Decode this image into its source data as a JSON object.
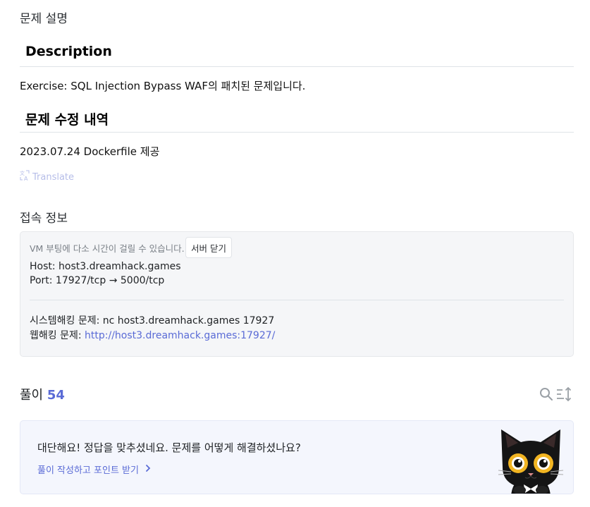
{
  "problem_description": {
    "section_label": "문제 설명",
    "heading": "Description",
    "text": "Exercise: SQL Injection Bypass WAF의 패치된 문제입니다.",
    "revision_heading": "문제 수정 내역",
    "revision_text": "2023.07.24 Dockerfile 제공",
    "translate_label": "Translate",
    "translate_icon": "translate-icon"
  },
  "connection": {
    "section_label": "접속 정보",
    "vm_note": "VM 부팅에 다소 시간이 걸릴 수 있습니다.",
    "close_server_label": "서버 닫기",
    "host_line": "Host: host3.dreamhack.games",
    "port_line": "Port:  17927/tcp → 5000/tcp",
    "system_hacking_prefix": "시스템해킹 문제: ",
    "system_hacking_value": "nc host3.dreamhack.games 17927",
    "web_hacking_prefix": "웹해킹 문제: ",
    "web_hacking_link": "http://host3.dreamhack.games:17927/"
  },
  "solutions": {
    "title": "풀이",
    "count": "54",
    "search_icon": "search-icon",
    "sort_icon": "sort-icon"
  },
  "cta": {
    "title": "대단해요! 정답을 맞추셨네요. 문제를 어떻게 해결하셨나요?",
    "link_label": "풀이 작성하고 포인트 받기",
    "link_icon": "chevron-right-icon",
    "mascot": "black-cat-mascot"
  },
  "colors": {
    "accent": "#5a6bd6",
    "translate": "#b6bde8",
    "box_bg": "#f5f6f8",
    "cta_bg": "#f4f6fd"
  }
}
